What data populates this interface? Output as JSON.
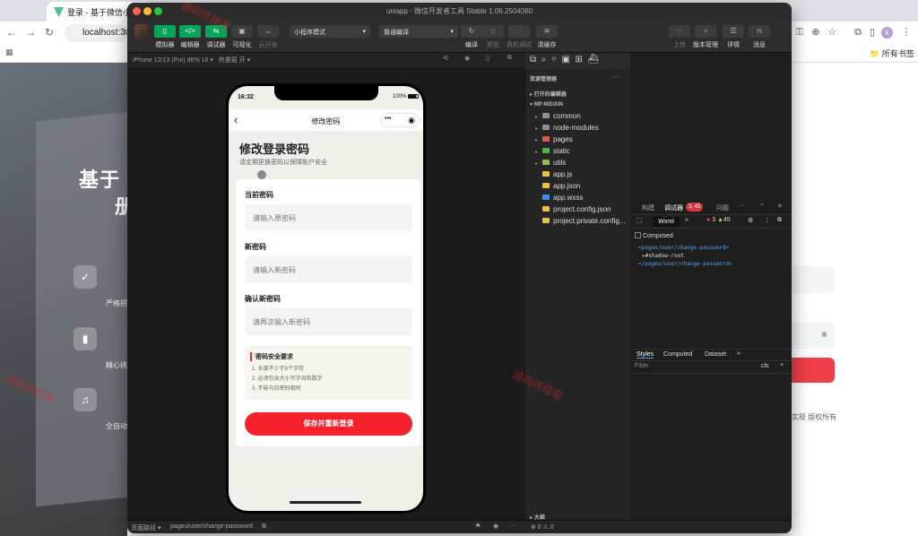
{
  "browser": {
    "tab_title": "登录 - 基于微信小程序",
    "url": "localhost:30",
    "bookmarks_all": "所有书签",
    "profile_initial": "k"
  },
  "background_page": {
    "heading": "基于",
    "heading2": "册",
    "features": [
      "严格把",
      "精心挑",
      "全自动"
    ],
    "copyright": "实现 版权所有"
  },
  "devtools": {
    "window_title": "uniapp - 微信开发者工具 Stable 1.06.2504060",
    "toolbar": {
      "simulator": "模拟器",
      "editor": "编辑器",
      "debugger": "调试器",
      "visual": "可视化",
      "cloud": "云开发",
      "mode": "小程序模式",
      "compile_mode": "普通编译",
      "compile": "编译",
      "preview": "预览",
      "real_debug": "真机调试",
      "clear_cache": "清缓存",
      "upload": "上传",
      "version": "版本管理",
      "details": "详情",
      "messages": "消息"
    },
    "sim_bar": {
      "device": "iPhone 12/13 (Pro) 96% 16 ▾",
      "hotreload": "热重载 开 ▾"
    },
    "explorer": {
      "title": "资源管理器",
      "open_editors": "打开的编辑器",
      "project": "MP-WEIXIN",
      "items": [
        {
          "name": "common",
          "color": "#8a8f98"
        },
        {
          "name": "node-modules",
          "color": "#8a8f98"
        },
        {
          "name": "pages",
          "color": "#e2574c"
        },
        {
          "name": "static",
          "color": "#4caf50"
        },
        {
          "name": "utils",
          "color": "#8bc34a"
        },
        {
          "name": "app.js",
          "color": "#e6c13d"
        },
        {
          "name": "app.json",
          "color": "#e6c13d"
        },
        {
          "name": "app.wxss",
          "color": "#3b8eea"
        },
        {
          "name": "project.config.json",
          "color": "#e6c13d"
        },
        {
          "name": "project.private.config...",
          "color": "#e6c13d"
        }
      ],
      "outline": "大纲",
      "problems": "⊗ 0 ⚠ 0"
    },
    "debug_panel": {
      "tabs": [
        "构建",
        "调试器",
        "问题"
      ],
      "badge": "3, 45",
      "wxml_tab": "Wxml",
      "errors": "3",
      "warnings": "45",
      "composed": "Composed",
      "code_lines": [
        "<pages/user/change-password>",
        "▸#shadow-root",
        "</pages/user/change-password>"
      ],
      "style_tabs": [
        "Styles",
        "Computed",
        "Dataset"
      ],
      "filter": "Filter",
      "cls": ".cls"
    },
    "statusbar": {
      "label": "页面路径 ▾",
      "path": "pages/user/change-password"
    },
    "watermark": "源码终结者"
  },
  "phone": {
    "time": "16:32",
    "battery": "100%",
    "nav_title": "修改密码",
    "heading": "修改登录密码",
    "subtitle": "请定期更换密码以保障账户安全",
    "current_label": "当前密码",
    "current_placeholder": "请输入原密码",
    "new_label": "新密码",
    "new_placeholder": "请输入新密码",
    "confirm_label": "确认新密码",
    "confirm_placeholder": "请再次输入新密码",
    "req_title": "密码安全要求",
    "requirements": [
      "1. 长度不少于8个字符",
      "2. 必须包含大小写字母和数字",
      "3. 不能与旧密码相同"
    ],
    "save_button": "保存并重新登录"
  }
}
